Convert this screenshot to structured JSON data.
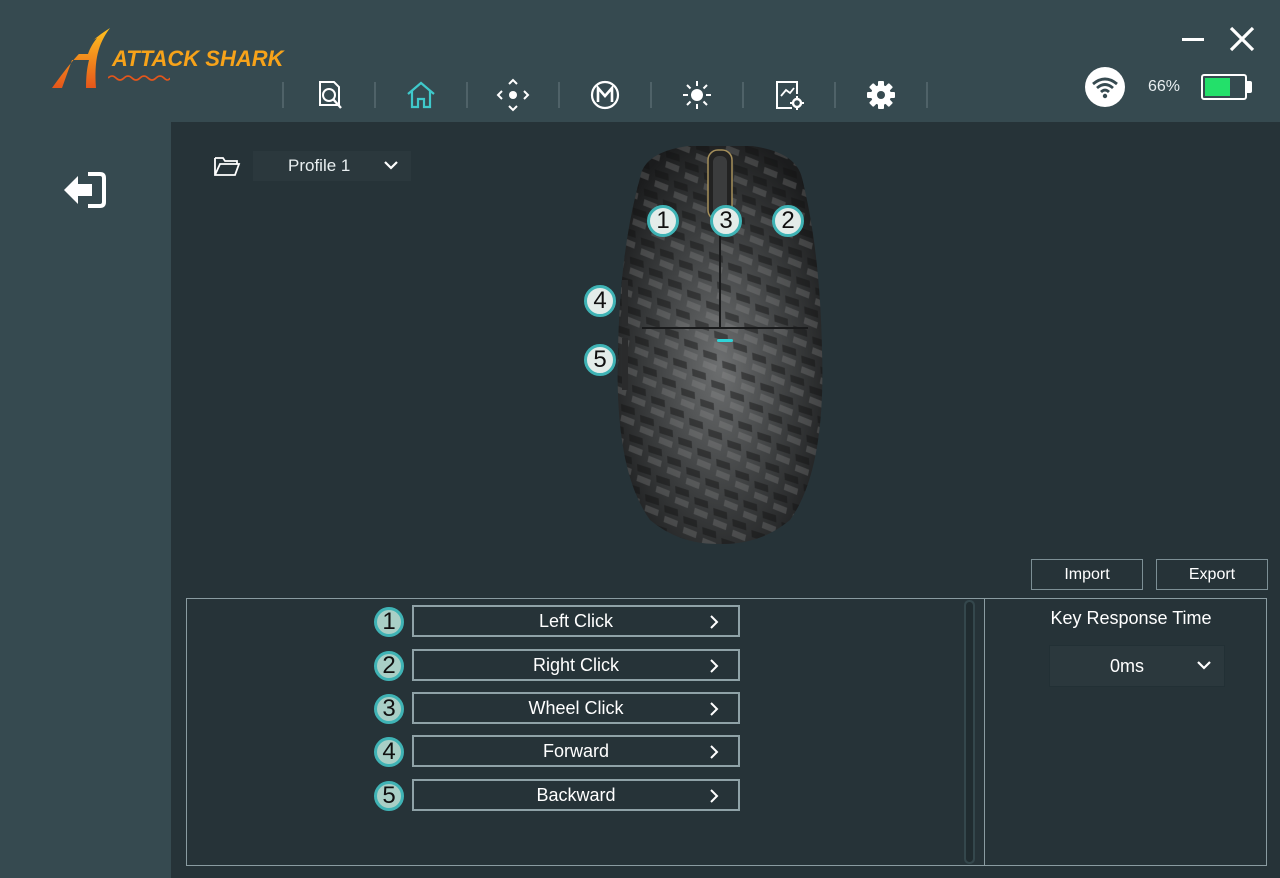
{
  "app": {
    "brand": "ATTACK SHARK",
    "brand_accent": "#f7a31a",
    "accent": "#3fb3b5"
  },
  "nav": {
    "items": [
      {
        "name": "device-info",
        "icon": "search-document-icon"
      },
      {
        "name": "home",
        "icon": "home-icon",
        "active": true
      },
      {
        "name": "performance",
        "icon": "crosshair-icon"
      },
      {
        "name": "macro",
        "icon": "macro-m-icon"
      },
      {
        "name": "lighting",
        "icon": "brightness-icon"
      },
      {
        "name": "advanced-settings",
        "icon": "chart-gear-icon"
      },
      {
        "name": "settings",
        "icon": "gear-icon"
      }
    ]
  },
  "status": {
    "connection_icon": "wifi-icon",
    "battery_text": "66%",
    "battery_level": 0.66,
    "battery_color": "#23e06a"
  },
  "profile": {
    "selected": "Profile 1"
  },
  "mouse_badges": [
    "1",
    "3",
    "2",
    "4",
    "5"
  ],
  "actions": {
    "import_label": "Import",
    "export_label": "Export"
  },
  "buttons": [
    {
      "num": "1",
      "label": "Left Click"
    },
    {
      "num": "2",
      "label": "Right Click"
    },
    {
      "num": "3",
      "label": "Wheel Click"
    },
    {
      "num": "4",
      "label": "Forward"
    },
    {
      "num": "5",
      "label": "Backward"
    }
  ],
  "key_response": {
    "title": "Key Response Time",
    "value": "0ms"
  }
}
